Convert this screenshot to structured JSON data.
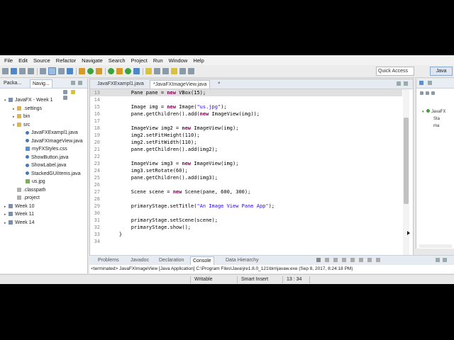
{
  "menu": [
    "File",
    "Edit",
    "Source",
    "Refactor",
    "Navigate",
    "Search",
    "Project",
    "Run",
    "Window",
    "Help"
  ],
  "quick_access": "Quick Access",
  "perspective": "Java",
  "left_tabs": [
    "Packa...",
    "Navig..."
  ],
  "tree": [
    {
      "label": "JavaFX - Week 1",
      "type": "proj",
      "indent": 0,
      "expanded": true
    },
    {
      "label": ".settings",
      "type": "fold",
      "indent": 1,
      "expanded": false
    },
    {
      "label": "bin",
      "type": "fold",
      "indent": 1,
      "expanded": false
    },
    {
      "label": "src",
      "type": "fold",
      "indent": 1,
      "expanded": true
    },
    {
      "label": "JavaFXExampl1.java",
      "type": "java",
      "indent": 2
    },
    {
      "label": "JavaFXImageView.java",
      "type": "java",
      "indent": 2
    },
    {
      "label": "myFXStyles.css",
      "type": "css",
      "indent": 2
    },
    {
      "label": "ShowButton.java",
      "type": "java",
      "indent": 2
    },
    {
      "label": "ShowLabel.java",
      "type": "java",
      "indent": 2
    },
    {
      "label": "StackedGUIItems.java",
      "type": "java",
      "indent": 2
    },
    {
      "label": "us.jpg",
      "type": "img",
      "indent": 2
    },
    {
      "label": ".classpath",
      "type": "file",
      "indent": 1
    },
    {
      "label": ".project",
      "type": "file",
      "indent": 1
    },
    {
      "label": "Week 10",
      "type": "proj",
      "indent": 0,
      "expanded": false
    },
    {
      "label": "Week 11",
      "type": "proj",
      "indent": 0,
      "expanded": false
    },
    {
      "label": "Week 14",
      "type": "proj",
      "indent": 0,
      "expanded": false
    }
  ],
  "editor_tabs": [
    "JavaFXExampl1.java",
    "*JavaFXImageView.java"
  ],
  "code_lines": [
    {
      "n": "13",
      "t": "        Pane pane = new VBox(15);"
    },
    {
      "n": "14",
      "t": ""
    },
    {
      "n": "15",
      "t": "        Image img = new Image(\"us.jpg\");"
    },
    {
      "n": "16",
      "t": "        pane.getChildren().add(new ImageView(img));"
    },
    {
      "n": "17",
      "t": ""
    },
    {
      "n": "18",
      "t": "        ImageView img2 = new ImageView(img);"
    },
    {
      "n": "19",
      "t": "        img2.setFitHeight(110);"
    },
    {
      "n": "20",
      "t": "        img2.setFitWidth(110);"
    },
    {
      "n": "21",
      "t": "        pane.getChildren().add(img2);"
    },
    {
      "n": "22",
      "t": ""
    },
    {
      "n": "23",
      "t": "        ImageView img3 = new ImageView(img);"
    },
    {
      "n": "24",
      "t": "        img3.setRotate(60);"
    },
    {
      "n": "25",
      "t": "        pane.getChildren().add(img3);"
    },
    {
      "n": "26",
      "t": ""
    },
    {
      "n": "27",
      "t": "        Scene scene = new Scene(pane, 600, 300);"
    },
    {
      "n": "28",
      "t": ""
    },
    {
      "n": "29",
      "t": "        primaryStage.setTitle(\"An Image View Pane App\");"
    },
    {
      "n": "30",
      "t": ""
    },
    {
      "n": "31",
      "t": "        primaryStage.setScene(scene);"
    },
    {
      "n": "32",
      "t": "        primaryStage.show();"
    },
    {
      "n": "33",
      "t": "    }"
    },
    {
      "n": "34",
      "t": ""
    }
  ],
  "outline": [
    "JavaFX",
    "Sta",
    "ma"
  ],
  "bottom_tabs": [
    "Problems",
    "Javadoc",
    "Declaration",
    "Console",
    "Data Hierarchy"
  ],
  "console_text": "<terminated> JavaFXImageView [Java Application] C:\\Program Files\\Java\\jre1.8.0_121\\bin\\javaw.exe (Sep 8, 2017, 8:24:18 PM)",
  "status": {
    "writable": "Writable",
    "insert": "Smart Insert",
    "position": "13 : 34"
  },
  "colors": {
    "keyword": "#7f0055",
    "string": "#2a00ff",
    "accent": "#4f86c6"
  }
}
